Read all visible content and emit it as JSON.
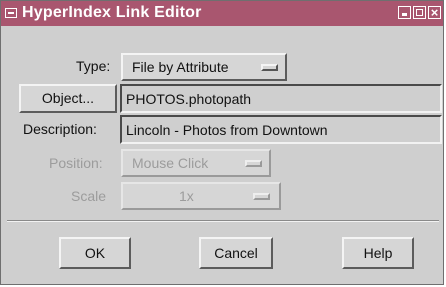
{
  "window": {
    "title": "HyperIndex Link Editor",
    "close_glyph": "×",
    "colors": {
      "titlebar": "#a9566f",
      "panel": "#cfcfcf"
    }
  },
  "form": {
    "type": {
      "label": "Type:",
      "value": "File by Attribute"
    },
    "object": {
      "button_label": "Object...",
      "value": "PHOTOS.photopath"
    },
    "description": {
      "label": "Description:",
      "value": "Lincoln -  Photos from Downtown"
    },
    "position": {
      "label": "Position:",
      "value": "Mouse Click",
      "enabled": false
    },
    "scale": {
      "label": "Scale",
      "value": "1x",
      "enabled": false
    }
  },
  "buttons": {
    "ok": "OK",
    "cancel": "Cancel",
    "help": "Help"
  },
  "icons": [
    "window-menu-icon",
    "minimize-icon",
    "maximize-icon",
    "close-icon",
    "option-menu-indicator-icon"
  ]
}
